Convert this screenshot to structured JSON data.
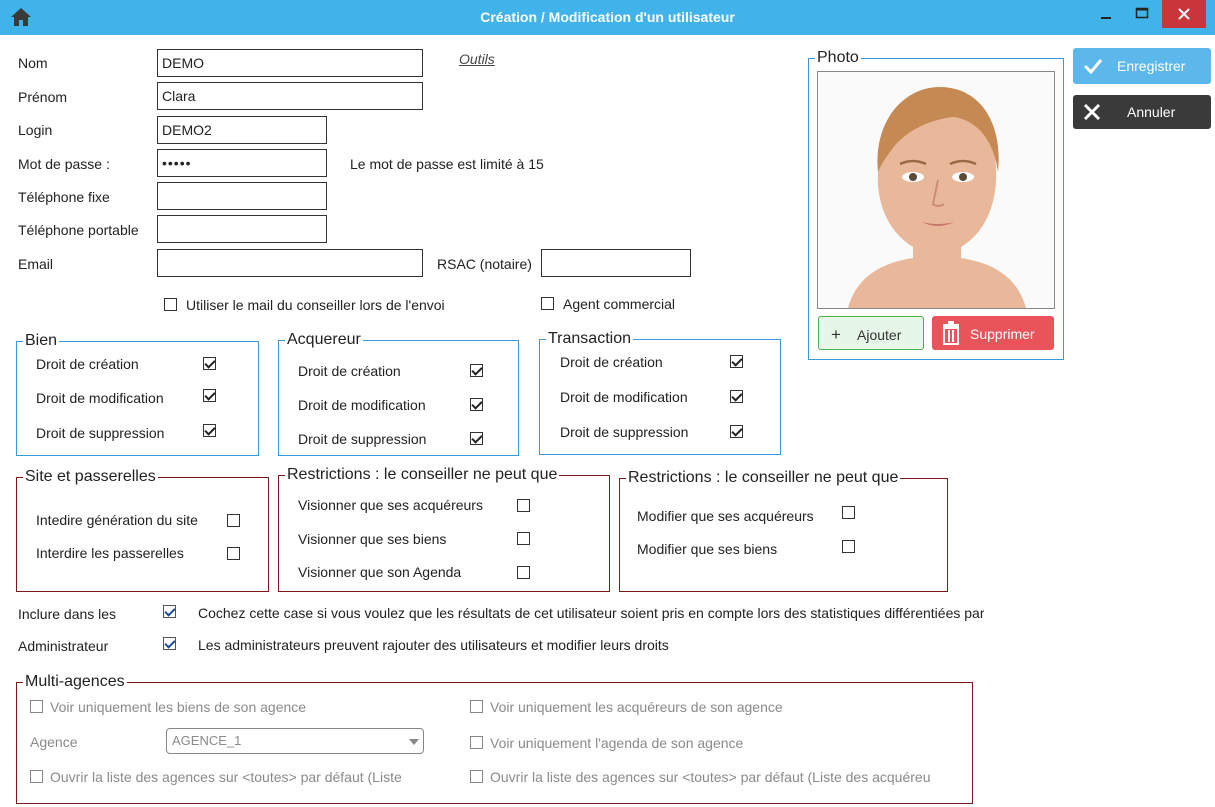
{
  "window": {
    "title": "Création / Modification d'un utilisateur"
  },
  "form": {
    "nom_label": "Nom",
    "nom_value": "DEMO",
    "outils_link": "Outils ",
    "prenom_label": "Prénom",
    "prenom_value": "Clara",
    "login_label": "Login",
    "login_value": "DEMO2",
    "password_label": "Mot de passe :",
    "password_value": "•••••",
    "password_hint": "Le mot de passe est limité à 15",
    "tel_fixe_label": "Téléphone fixe",
    "tel_fixe_value": "",
    "tel_portable_label": "Téléphone portable",
    "tel_portable_value": "",
    "email_label": "Email",
    "email_value": "",
    "rsac_label": "RSAC (notaire)",
    "rsac_value": "",
    "use_mail_label": "Utiliser le mail du conseiller lors de l'envoi",
    "use_mail_checked": false,
    "agent_commercial_label": "Agent commercial",
    "agent_commercial_checked": false
  },
  "photo": {
    "legend": "Photo",
    "add_label": "Ajouter",
    "delete_label": "Supprimer"
  },
  "actions": {
    "save_label": "Enregistrer",
    "cancel_label": "Annuler"
  },
  "bien": {
    "legend": "Bien",
    "items": [
      {
        "label": "Droit de création",
        "checked": true
      },
      {
        "label": "Droit de modification",
        "checked": true
      },
      {
        "label": "Droit de suppression",
        "checked": true
      }
    ]
  },
  "acquereur": {
    "legend": "Acquereur",
    "items": [
      {
        "label": "Droit de création",
        "checked": true
      },
      {
        "label": "Droit de modification",
        "checked": true
      },
      {
        "label": "Droit de suppression",
        "checked": true
      }
    ]
  },
  "transaction": {
    "legend": "Transaction",
    "items": [
      {
        "label": "Droit de création",
        "checked": true
      },
      {
        "label": "Droit de modification",
        "checked": true
      },
      {
        "label": "Droit de suppression",
        "checked": true
      }
    ]
  },
  "site": {
    "legend": "Site et passerelles",
    "items": [
      {
        "label": "Intedire génération du site",
        "checked": false
      },
      {
        "label": "Interdire les passerelles",
        "checked": false
      }
    ]
  },
  "restrictions_view": {
    "legend": "Restrictions : le conseiller ne peut que",
    "items": [
      {
        "label": "Visionner que ses acquéreurs",
        "checked": false
      },
      {
        "label": "Visionner que ses biens",
        "checked": false
      },
      {
        "label": "Visionner que son Agenda",
        "checked": false
      }
    ]
  },
  "restrictions_edit": {
    "legend": "Restrictions : le conseiller ne peut que",
    "items": [
      {
        "label": "Modifier que ses acquéreurs",
        "checked": false
      },
      {
        "label": "Modifier que ses biens",
        "checked": false
      }
    ]
  },
  "stats": {
    "label": "Inclure dans les",
    "checked": true,
    "description": "Cochez cette case si vous voulez que les résultats de cet utilisateur soient pris en compte lors des statistiques différentiées par"
  },
  "admin": {
    "label": "Administrateur",
    "checked": true,
    "description": "Les administrateurs preuvent rajouter des utilisateurs et modifier leurs droits"
  },
  "multi": {
    "legend": "Multi-agences",
    "voir_biens": "Voir uniquement les biens de son agence",
    "voir_acquereurs": "Voir uniquement les acquéreurs de son agence",
    "agence_label": "Agence",
    "agence_value": "AGENCE_1",
    "voir_agenda": "Voir uniquement l'agenda de son agence",
    "ouvrir_liste_biens": "Ouvrir la liste des agences sur <toutes> par défaut (Liste",
    "ouvrir_liste_acquereurs": "Ouvrir la liste des agences sur <toutes> par défaut (Liste des acquéreu"
  },
  "colors": {
    "titlebar": "#3fb3ea",
    "group_blue": "#3a9ad9",
    "group_red": "#7a1a1a",
    "save": "#5cb8ea",
    "cancel": "#3a3a3a",
    "delete": "#e8545a"
  }
}
